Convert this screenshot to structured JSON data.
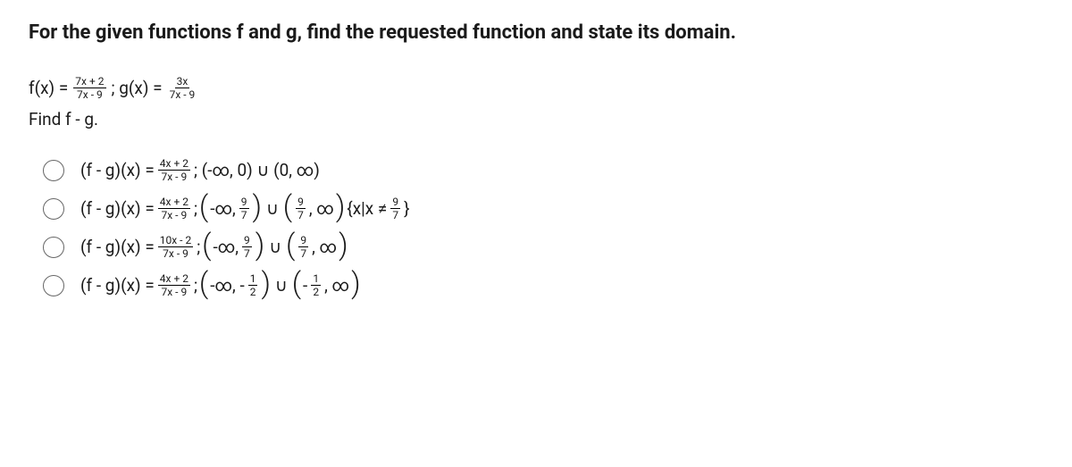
{
  "title": "For the given functions f and g, find the requested function and state its domain.",
  "definitions": {
    "fx_prefix": "f(x) = ",
    "f_num": "7x + 2",
    "f_den": "7x - 9",
    "sep": "; g(x) = ",
    "g_num": "3x",
    "g_den": "7x - 9"
  },
  "find_text": "Find f - g.",
  "options": {
    "a": {
      "lhs": "(f - g)(x) = ",
      "num": "4x + 2",
      "den": "7x - 9",
      "domain": "; (-∞, 0) ∪ (0, ∞)"
    },
    "b": {
      "lhs": "(f - g)(x) = ",
      "num": "4x + 2",
      "den": "7x - 9",
      "semi": "; ",
      "int1_lo": "-∞, ",
      "int1_hi_num": "9",
      "int1_hi_den": "7",
      "union": " ∪ ",
      "int2_lo_num": "9",
      "int2_lo_den": "7",
      "int2_hi": ", ∞",
      "set_open": " {x|x ≠ ",
      "set_num": "9",
      "set_den": "7",
      "set_close": "}"
    },
    "c": {
      "lhs": "(f - g)(x) = ",
      "num": "10x - 2",
      "den": "7x - 9",
      "semi": "; ",
      "int1_lo": "-∞, ",
      "int1_hi_num": "9",
      "int1_hi_den": "7",
      "union": " ∪ ",
      "int2_lo_num": "9",
      "int2_lo_den": "7",
      "int2_hi": ", ∞"
    },
    "d": {
      "lhs": "(f - g)(x) = ",
      "num": "4x + 2",
      "den": "7x - 9",
      "semi": "; ",
      "int1_lo": "-∞, -",
      "int1_hi_num": "1",
      "int1_hi_den": "2",
      "union": " ∪ ",
      "int2_lo_num": "1",
      "int2_lo_den": "2",
      "int2_lo_sign": "-",
      "int2_hi": ", ∞"
    }
  }
}
